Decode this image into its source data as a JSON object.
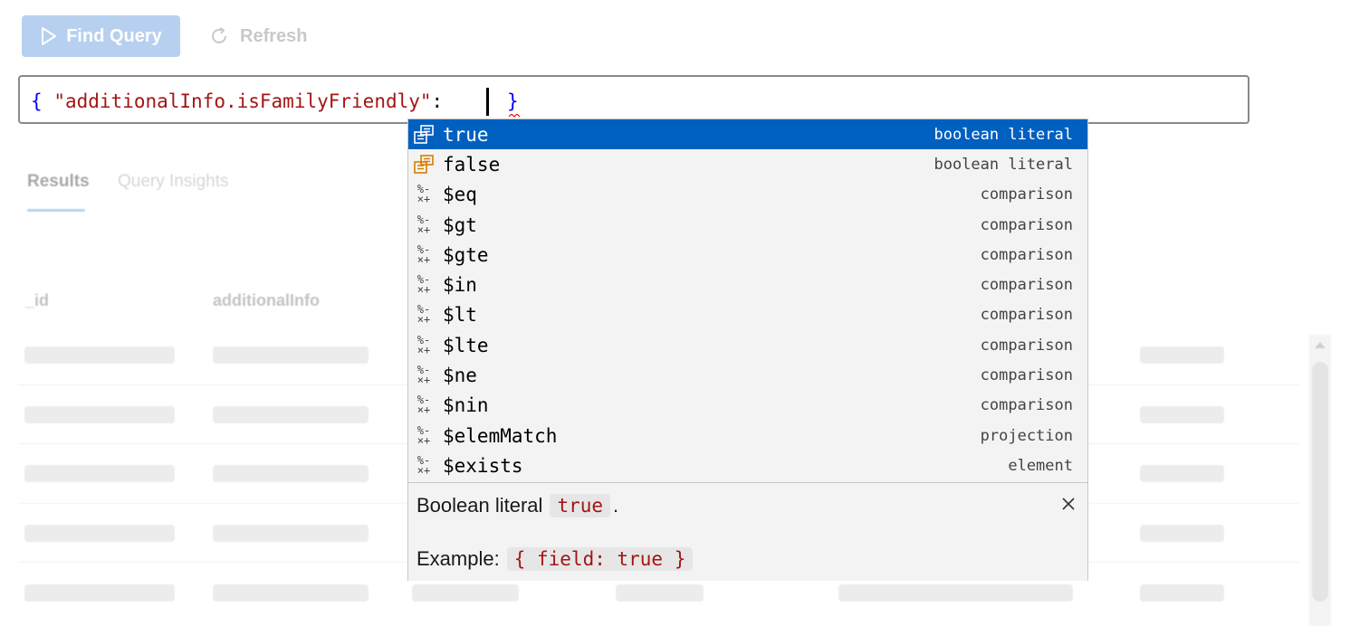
{
  "toolbar": {
    "find_label": "Find Query",
    "refresh_label": "Refresh"
  },
  "editor": {
    "open_brace": "{",
    "key": "\"additionalInfo.isFamilyFriendly\"",
    "colon": ":",
    "close_brace": "}"
  },
  "tabs": {
    "results": "Results",
    "insights": "Query Insights"
  },
  "table": {
    "columns": [
      "_id",
      "additionalInfo"
    ]
  },
  "suggest": {
    "items": [
      {
        "label": "true",
        "detail": "boolean literal",
        "icon": "literal-icon",
        "selected": true
      },
      {
        "label": "false",
        "detail": "boolean literal",
        "icon": "literal-icon"
      },
      {
        "label": "$eq",
        "detail": "comparison",
        "icon": "operator-icon"
      },
      {
        "label": "$gt",
        "detail": "comparison",
        "icon": "operator-icon"
      },
      {
        "label": "$gte",
        "detail": "comparison",
        "icon": "operator-icon"
      },
      {
        "label": "$in",
        "detail": "comparison",
        "icon": "operator-icon"
      },
      {
        "label": "$lt",
        "detail": "comparison",
        "icon": "operator-icon"
      },
      {
        "label": "$lte",
        "detail": "comparison",
        "icon": "operator-icon"
      },
      {
        "label": "$ne",
        "detail": "comparison",
        "icon": "operator-icon"
      },
      {
        "label": "$nin",
        "detail": "comparison",
        "icon": "operator-icon"
      },
      {
        "label": "$elemMatch",
        "detail": "projection",
        "icon": "operator-icon"
      },
      {
        "label": "$exists",
        "detail": "element",
        "icon": "operator-icon"
      }
    ],
    "details": {
      "desc_prefix": "Boolean literal",
      "desc_code": "true",
      "desc_suffix": ".",
      "example_prefix": "Example:",
      "example_code": "{ field: true }"
    }
  },
  "colors": {
    "selection": "#0060c0",
    "primary_disabled": "#b7d0ef",
    "string": "#a31515",
    "brace": "#0000ff"
  }
}
